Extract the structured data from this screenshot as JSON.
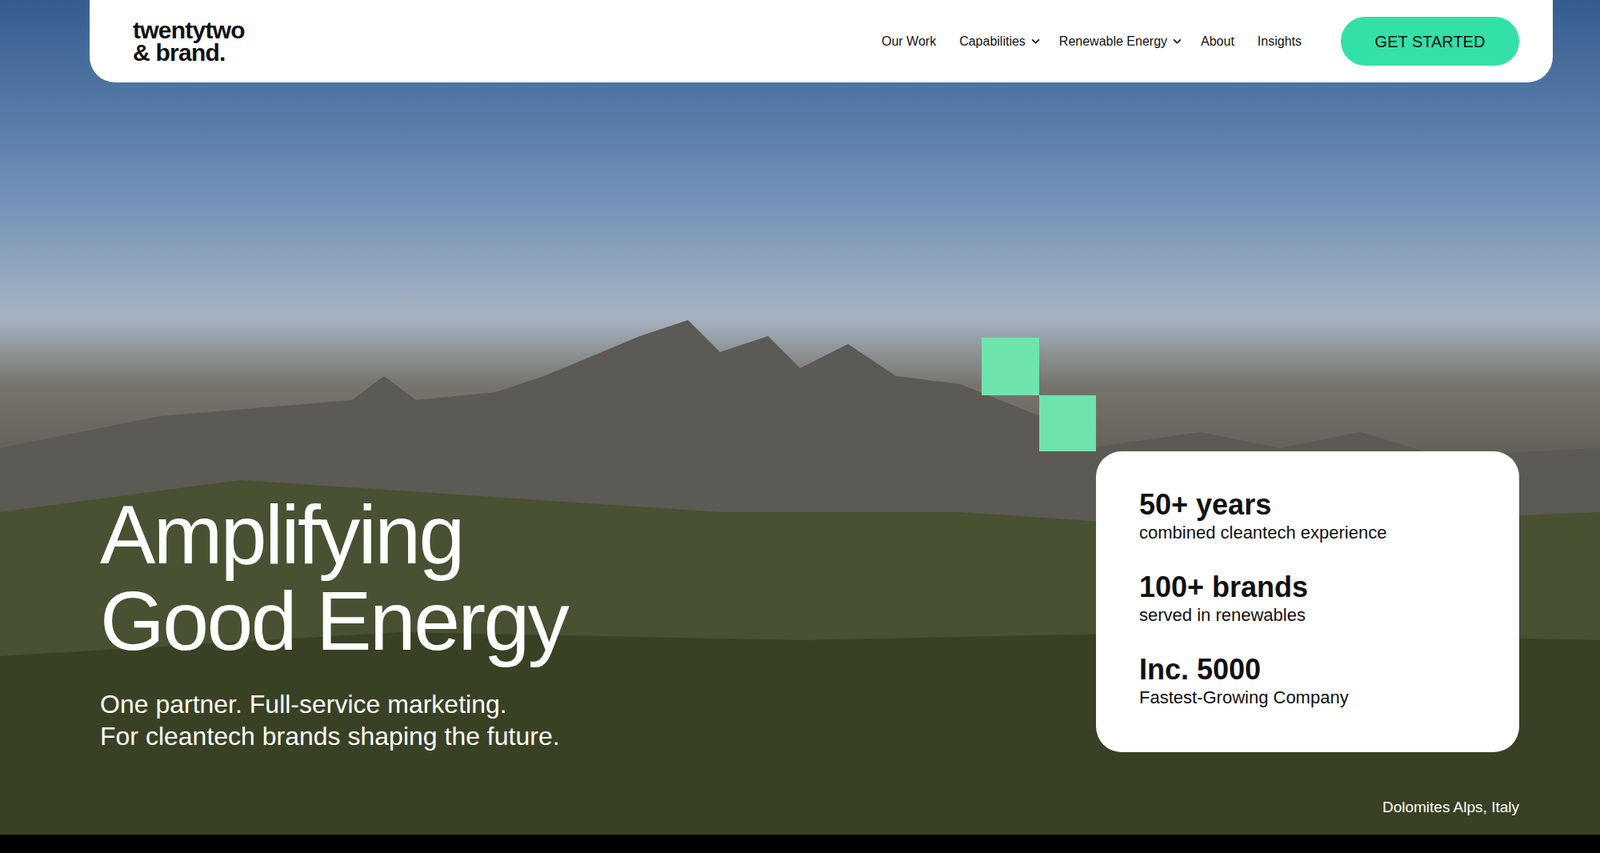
{
  "logo": {
    "line1": "twentytwo",
    "line2": "& brand."
  },
  "nav": {
    "items": [
      {
        "label": "Our Work",
        "dropdown": false
      },
      {
        "label": "Capabilities",
        "dropdown": true
      },
      {
        "label": "Renewable Energy",
        "dropdown": true
      },
      {
        "label": "About",
        "dropdown": false
      },
      {
        "label": "Insights",
        "dropdown": false
      }
    ],
    "cta": "GET STARTED"
  },
  "hero": {
    "title_lines": [
      "Amplifying",
      "Good Energy"
    ],
    "subtitle_lines": [
      "One partner. Full-service marketing.",
      "For cleantech brands shaping the future."
    ]
  },
  "stats": [
    {
      "value": "50+ years",
      "label": "combined cleantech experience"
    },
    {
      "value": "100+ brands",
      "label": "served in renewables"
    },
    {
      "value": "Inc. 5000",
      "label": "Fastest-Growing Company"
    }
  ],
  "caption": "Dolomites Alps, Italy"
}
